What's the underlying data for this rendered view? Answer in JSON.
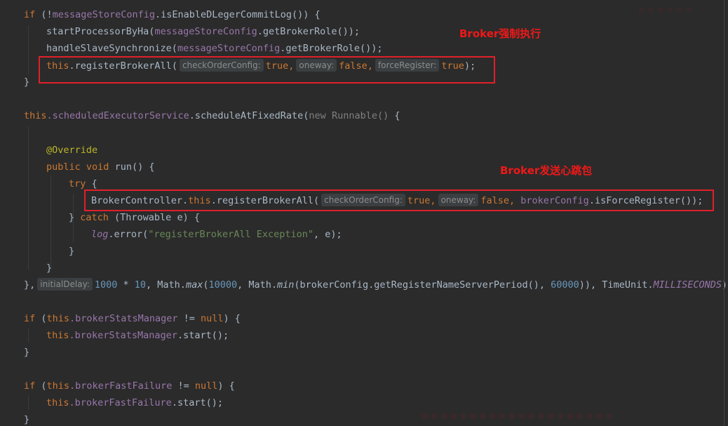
{
  "code": {
    "l1": {
      "if": "if",
      "not_call": "(!",
      "receiver": "messageStoreConfig",
      "call": ".isEnableDLegerCommitLog()) {"
    },
    "l2": {
      "name": "startProcessorByHa(",
      "receiver": "messageStoreConfig",
      "call": ".getBrokerRole());"
    },
    "l3": {
      "name": "handleSlaveSynchronize(",
      "receiver": "messageStoreConfig",
      "call": ".getBrokerRole());"
    },
    "l4": {
      "this": "this",
      "call": ".registerBrokerAll(",
      "hint1": "checkOrderConfig:",
      "v1": "true",
      "c1": ",",
      "hint2": "oneway:",
      "v2": "false",
      "c2": ",",
      "hint3": "forceRegister:",
      "v3": "true",
      "end": ");"
    },
    "l5": {
      "text": "}"
    },
    "l7": {
      "this": "this",
      "field": ".scheduledExecutorService",
      "call": ".scheduleAtFixedRate(",
      "new": "new",
      "runnable": "Runnable()",
      "brace": " {"
    },
    "l9": {
      "text": "@Override"
    },
    "l10": {
      "public": "public",
      "void": "void",
      "name": "run() {"
    },
    "l11": {
      "try": "try",
      "brace": " {"
    },
    "l12": {
      "cls": "BrokerController.",
      "this": "this",
      "call": ".registerBrokerAll(",
      "hint1": "checkOrderConfig:",
      "v1": "true",
      "c1": ",",
      "hint2": "oneway:",
      "v2": "false",
      "c2": ",",
      "receiver": "brokerConfig",
      "end": ".isForceRegister());"
    },
    "l13": {
      "close": "} ",
      "catch": "catch",
      "rest": " (Throwable e) {"
    },
    "l14": {
      "log": "log",
      "call": ".error(",
      "str": "\"registerBrokerAll Exception\"",
      "rest": ", e);"
    },
    "l15": {
      "text": "}"
    },
    "l16": {
      "text": "}"
    },
    "l17": {
      "start": "},",
      "hint": "initialDelay:",
      "n1": "1000",
      "op": " * ",
      "n2": "10",
      "c1": ", Math.",
      "max": "max",
      "p1": "(",
      "n3": "10000",
      "c2": ", Math.",
      "min": "min",
      "p2": "(brokerConfig.getRegisterNameServerPeriod(), ",
      "n4": "60000",
      "p3": ")), TimeUnit.",
      "unit": "MILLISECONDS",
      "end": ");"
    },
    "l19": {
      "if": "if",
      "open": " (",
      "this": "this",
      "field": ".brokerStatsManager",
      "op": " != ",
      "null": "null",
      "end": ") {"
    },
    "l20": {
      "this": "this",
      "field": ".brokerStatsManager",
      "end": ".start();"
    },
    "l21": {
      "text": "}"
    },
    "l23": {
      "if": "if",
      "open": " (",
      "this": "this",
      "field": ".brokerFastFailure",
      "op": " != ",
      "null": "null",
      "end": ") {"
    },
    "l24": {
      "this": "this",
      "field": ".brokerFastFailure",
      "end": ".start();"
    },
    "l25": {
      "text": "}"
    }
  },
  "annotations": {
    "note1": "Broker强制执行",
    "note2": "Broker发送心跳包"
  },
  "colors": {
    "background": "#2b2b2b",
    "keyword": "#cc7832",
    "field": "#9876aa",
    "number": "#6897bb",
    "string": "#6a8759",
    "annotation": "#bbb529",
    "highlight_box": "#e0202a"
  }
}
